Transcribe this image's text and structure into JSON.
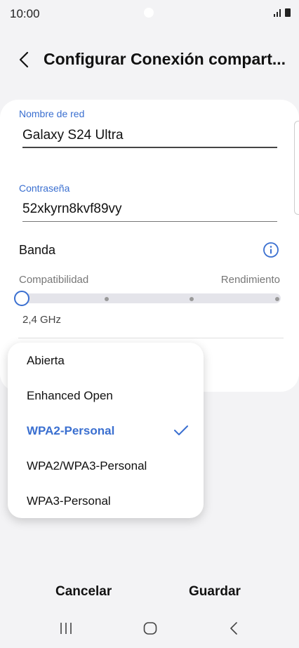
{
  "status_bar": {
    "time": "10:00"
  },
  "header": {
    "title": "Configurar Conexión compart..."
  },
  "form": {
    "network_name": {
      "label": "Nombre de red",
      "value": "Galaxy S24 Ultra"
    },
    "password": {
      "label": "Contraseña",
      "value": "52xkyrn8kvf89vy"
    },
    "band": {
      "label": "Banda",
      "left_label": "Compatibilidad",
      "right_label": "Rendimiento",
      "selected_value": "2,4 GHz",
      "slider_position": 0,
      "slider_steps": 4
    }
  },
  "security_menu": {
    "options": [
      "Abierta",
      "Enhanced Open",
      "WPA2-Personal",
      "WPA2/WPA3-Personal",
      "WPA3-Personal"
    ],
    "selected": "WPA2-Personal"
  },
  "actions": {
    "cancel": "Cancelar",
    "save": "Guardar"
  },
  "navigation": {
    "icons": [
      "recent-apps-icon",
      "home-icon",
      "back-icon"
    ]
  },
  "colors": {
    "accent": "#3a6fd0",
    "background": "#f3f3f5",
    "card": "#ffffff"
  }
}
